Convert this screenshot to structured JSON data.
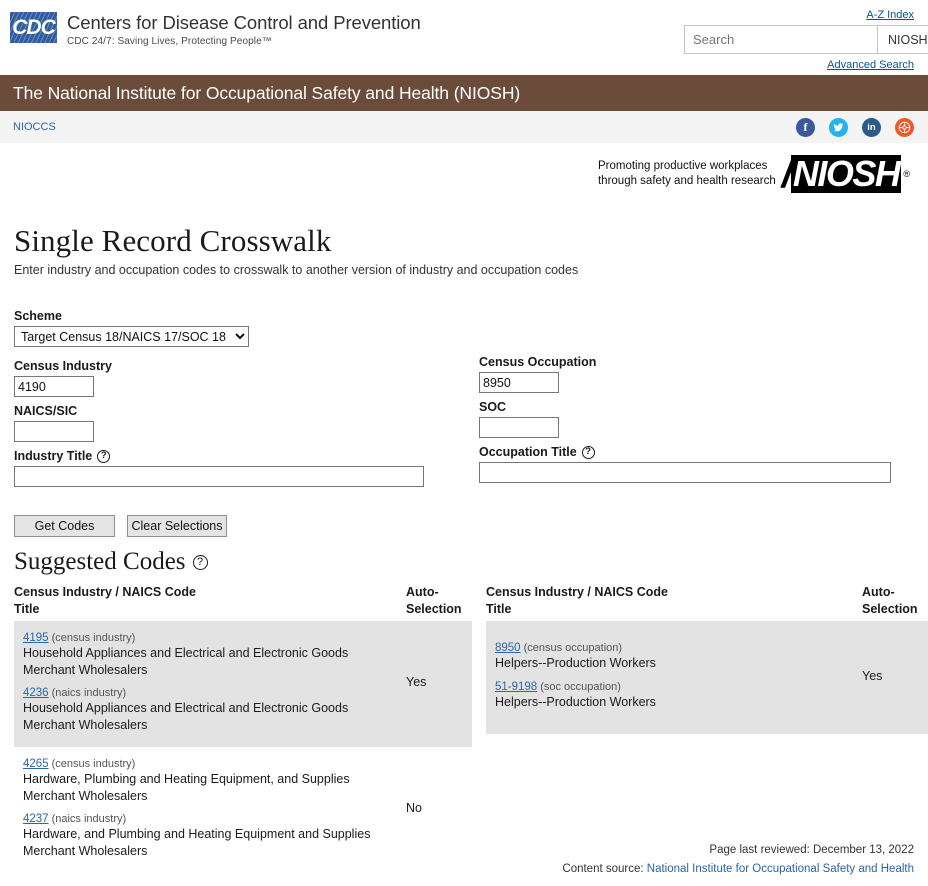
{
  "header": {
    "logo_text": "CDC",
    "agency_title": "Centers for Disease Control and Prevention",
    "tagline": "CDC 24/7: Saving Lives, Protecting People™",
    "az_index": "A-Z Index",
    "advanced_search": "Advanced Search",
    "search": {
      "placeholder": "Search",
      "value": "",
      "scope": "NIOSH"
    }
  },
  "banner": {
    "title": "The National Institute for Occupational Safety and Health (NIOSH)"
  },
  "breadcrumb": {
    "items": [
      "NIOCCS"
    ]
  },
  "social": [
    {
      "name": "facebook",
      "glyph": "f"
    },
    {
      "name": "twitter",
      "glyph": "✑"
    },
    {
      "name": "linkedin",
      "glyph": "in"
    },
    {
      "name": "syndicate",
      "glyph": "⊛"
    }
  ],
  "niosh_logo": {
    "tagline_line1": "Promoting productive workplaces",
    "tagline_line2": "through safety and health research",
    "wordmark": "NIOSH",
    "registered": "®"
  },
  "page": {
    "title": "Single Record Crosswalk",
    "subtitle": "Enter industry and occupation codes to crosswalk to another version of industry and occupation codes"
  },
  "form": {
    "scheme": {
      "label": "Scheme",
      "selected": "Target Census 18/NAICS 17/SOC 18",
      "options": [
        "Target Census 18/NAICS 17/SOC 18"
      ]
    },
    "census_industry": {
      "label": "Census Industry",
      "value": "4190",
      "placeholder": ""
    },
    "naics_sic": {
      "label": "NAICS/SIC",
      "value": "",
      "placeholder": ""
    },
    "industry_title": {
      "label": "Industry Title",
      "value": "",
      "placeholder": "",
      "help": "?"
    },
    "census_occupation": {
      "label": "Census Occupation",
      "value": "8950",
      "placeholder": ""
    },
    "soc": {
      "label": "SOC",
      "value": "",
      "placeholder": ""
    },
    "occupation_title": {
      "label": "Occupation Title",
      "value": "",
      "placeholder": "",
      "help": "?"
    },
    "buttons": {
      "get_codes": "Get Codes",
      "clear_selections": "Clear Selections"
    }
  },
  "results": {
    "heading": "Suggested Codes",
    "heading_help": "?",
    "left": {
      "header_code": "Census Industry / NAICS Code",
      "header_title": "Title",
      "header_auto_line1": "Auto-",
      "header_auto_line2": "Selection",
      "groups": [
        {
          "auto_selection": "Yes",
          "shaded": true,
          "items": [
            {
              "code": "4195",
              "kind": "(census industry)",
              "title": "Household Appliances and Electrical and Electronic Goods Merchant Wholesalers"
            },
            {
              "code": "4236",
              "kind": "(naics industry)",
              "title": "Household Appliances and Electrical and Electronic Goods Merchant Wholesalers"
            }
          ]
        },
        {
          "auto_selection": "No",
          "shaded": false,
          "items": [
            {
              "code": "4265",
              "kind": "(census industry)",
              "title": "Hardware, Plumbing and Heating Equipment, and Supplies Merchant Wholesalers"
            },
            {
              "code": "4237",
              "kind": "(naics industry)",
              "title": "Hardware, and Plumbing and Heating Equipment and Supplies Merchant Wholesalers"
            }
          ]
        }
      ]
    },
    "right": {
      "header_code": "Census Industry / NAICS Code",
      "header_title": "Title",
      "header_auto_line1": "Auto-",
      "header_auto_line2": "Selection",
      "groups": [
        {
          "auto_selection": "Yes",
          "shaded": true,
          "items": [
            {
              "code": "8950",
              "kind": "(census occupation)",
              "title": "Helpers--Production Workers"
            },
            {
              "code": "51-9198",
              "kind": "(soc occupation)",
              "title": "Helpers--Production Workers"
            }
          ]
        }
      ]
    }
  },
  "footer": {
    "last_reviewed": "Page last reviewed: December 13, 2022",
    "content_source_label": "Content source:",
    "content_source_link": "National Institute for Occupational Safety and Health"
  }
}
